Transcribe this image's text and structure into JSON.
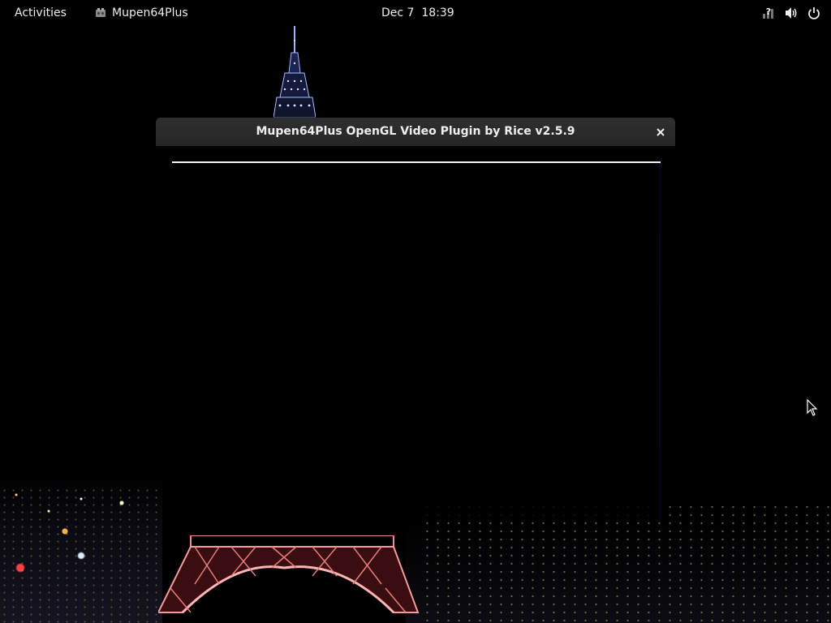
{
  "top_bar": {
    "activities_label": "Activities",
    "app_name": "Mupen64Plus",
    "app_icon": "mupen64-app-icon",
    "clock": "Dec 7  18:39",
    "tray_icons": [
      "network-help-icon",
      "volume-icon",
      "power-icon"
    ]
  },
  "window": {
    "title": "Mupen64Plus OpenGL Video Plugin by Rice v2.5.9",
    "close_icon": "close-icon"
  },
  "colors": {
    "top_bar_bg": "#000000",
    "titlebar_bg": "#2b2b2b",
    "text": "#eeeeec",
    "eiffel_lights": "#e88080",
    "tower_lights": "#8aa8ff"
  }
}
